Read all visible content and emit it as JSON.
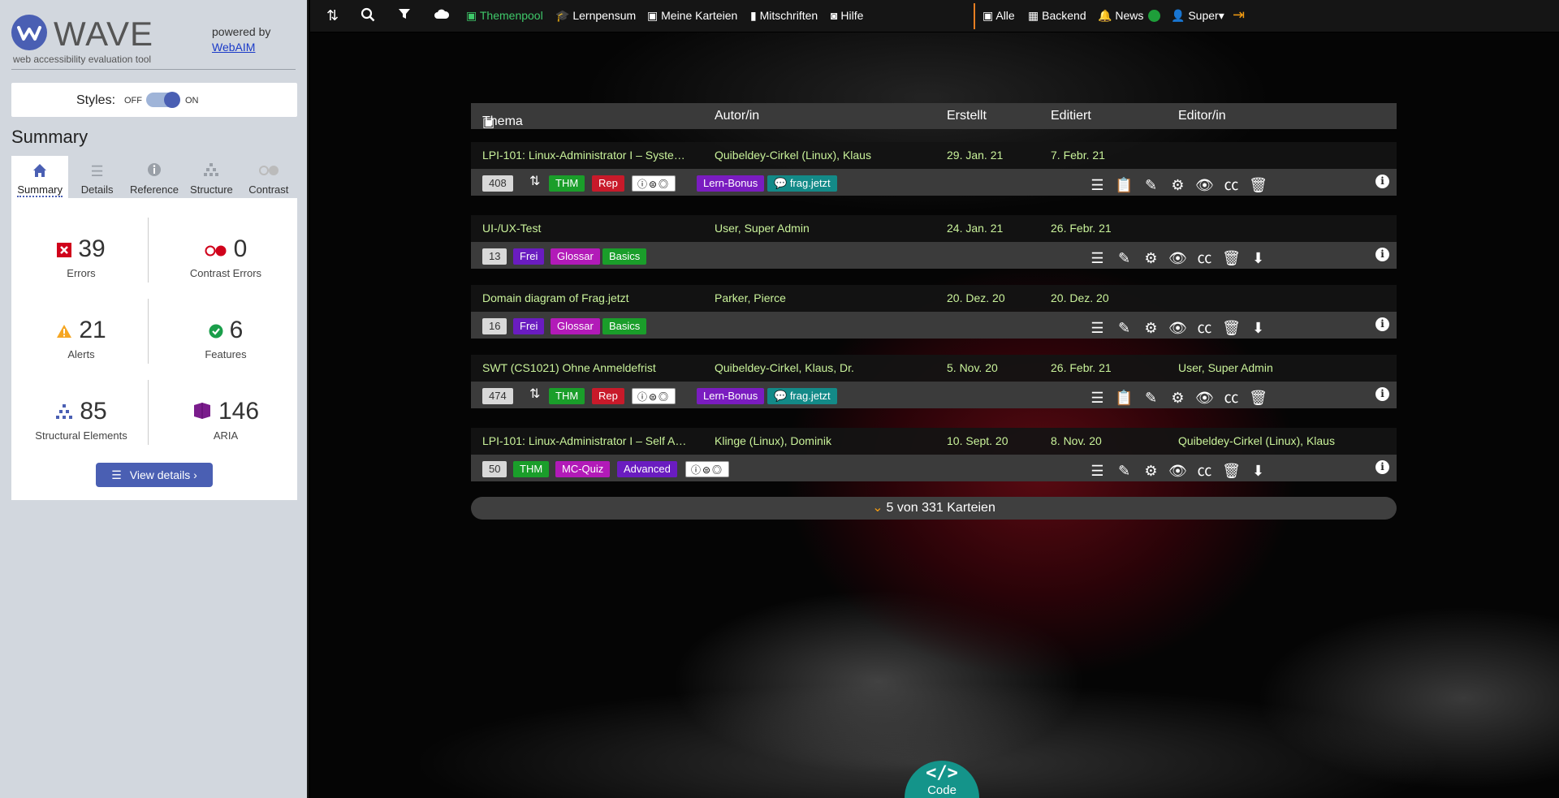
{
  "wave": {
    "logo_text": "WAVE",
    "tagline": "web accessibility evaluation tool",
    "powered_by": "powered by",
    "webaim_link": "WebAIM",
    "styles_label": "Styles:",
    "styles_off": "OFF",
    "styles_on": "ON",
    "summary_title": "Summary",
    "tabs": [
      {
        "label": "Summary",
        "icon": "home-icon"
      },
      {
        "label": "Details",
        "icon": "list-icon"
      },
      {
        "label": "Reference",
        "icon": "info-icon"
      },
      {
        "label": "Structure",
        "icon": "structure-icon"
      },
      {
        "label": "Contrast",
        "icon": "contrast-icon"
      }
    ],
    "stats": {
      "errors": {
        "value": "39",
        "label": "Errors"
      },
      "contrast_errors": {
        "value": "0",
        "label": "Contrast Errors"
      },
      "alerts": {
        "value": "21",
        "label": "Alerts"
      },
      "features": {
        "value": "6",
        "label": "Features"
      },
      "structural": {
        "value": "85",
        "label": "Structural Elements"
      },
      "aria": {
        "value": "146",
        "label": "ARIA"
      }
    },
    "view_details": "View details ›"
  },
  "nav": {
    "themenpool": "Themenpool",
    "lernpensum": "Lernpensum",
    "meine_karteien": "Meine Karteien",
    "mitschriften": "Mitschriften",
    "hilfe": "Hilfe",
    "alle": "Alle",
    "backend": "Backend",
    "news": "News",
    "user": "Super"
  },
  "table": {
    "headers": {
      "thema": "Thema",
      "autor": "Autor/in",
      "erstellt": "Erstellt",
      "editiert": "Editiert",
      "editor": "Editor/in"
    },
    "rows": [
      {
        "title": "LPI-101: Linux-Administrator I – Syste…",
        "author": "Quibeldey-Cirkel (Linux), Klaus",
        "created": "29. Jan. 21",
        "edited": "7. Febr. 21",
        "editor": "",
        "count": "408",
        "badges": [
          "THM",
          "Rep",
          "Lern-Bonus",
          "frag.jetzt"
        ]
      },
      {
        "title": "UI-/UX-Test",
        "author": "User, Super Admin",
        "created": "24. Jan. 21",
        "edited": "26. Febr. 21",
        "editor": "",
        "count": "13",
        "badges": [
          "Frei",
          "Glossar",
          "Basics"
        ]
      },
      {
        "title": "Domain diagram of Frag.jetzt",
        "author": "Parker, Pierce",
        "created": "20. Dez. 20",
        "edited": "20. Dez. 20",
        "editor": "",
        "count": "16",
        "badges": [
          "Frei",
          "Glossar",
          "Basics"
        ]
      },
      {
        "title": "SWT (CS1021) Ohne Anmeldefrist",
        "author": "Quibeldey-Cirkel, Klaus, Dr.",
        "created": "5. Nov. 20",
        "edited": "26. Febr. 21",
        "editor": "User, Super Admin",
        "count": "474",
        "badges": [
          "THM",
          "Rep",
          "Lern-Bonus",
          "frag.jetzt"
        ]
      },
      {
        "title": "LPI-101: Linux-Administrator I – Self A…",
        "author": "Klinge (Linux), Dominik",
        "created": "10. Sept. 20",
        "edited": "8. Nov. 20",
        "editor": "Quibeldey-Cirkel (Linux), Klaus",
        "count": "50",
        "badges": [
          "THM",
          "MC-Quiz",
          "Advanced"
        ]
      }
    ]
  },
  "pager": "5 von 331 Karteien",
  "code_button": "Code"
}
